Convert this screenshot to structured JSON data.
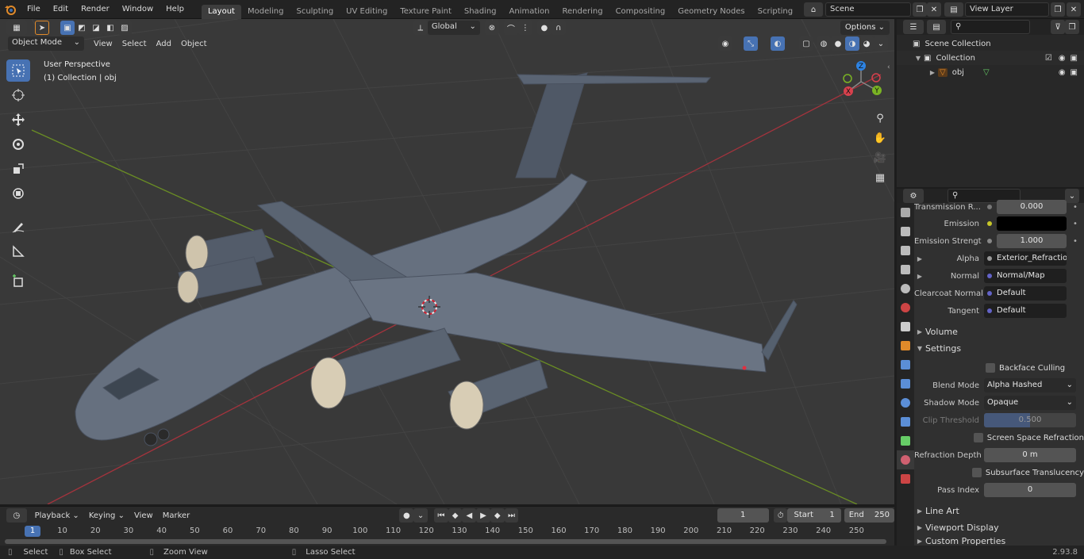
{
  "top_menu": {
    "file": "File",
    "edit": "Edit",
    "render": "Render",
    "window": "Window",
    "help": "Help"
  },
  "workspaces": [
    "Layout",
    "Modeling",
    "Sculpting",
    "UV Editing",
    "Texture Paint",
    "Shading",
    "Animation",
    "Rendering",
    "Compositing",
    "Geometry Nodes",
    "Scripting"
  ],
  "scene_field": "Scene",
  "view_layer_field": "View Layer",
  "viewport_header": {
    "mode": "Object Mode",
    "view": "View",
    "select": "Select",
    "add": "Add",
    "object": "Object",
    "transform_orientation": "Global",
    "options": "Options"
  },
  "viewport": {
    "perspective_label": "User Perspective",
    "collection_label": "(1) Collection | obj",
    "gizmo": {
      "x": "X",
      "y": "Y",
      "z": "Z"
    }
  },
  "timeline": {
    "playback": "Playback",
    "keying": "Keying",
    "view": "View",
    "marker": "Marker",
    "current_frame": "1",
    "start_label": "Start",
    "start_value": "1",
    "end_label": "End",
    "end_value": "250",
    "ticks": [
      "1",
      "10",
      "20",
      "30",
      "40",
      "50",
      "60",
      "70",
      "80",
      "90",
      "100",
      "110",
      "120",
      "130",
      "140",
      "150",
      "160",
      "170",
      "180",
      "190",
      "200",
      "210",
      "220",
      "230",
      "240",
      "250"
    ]
  },
  "statusbar": {
    "select": "Select",
    "box_select": "Box Select",
    "zoom_view": "Zoom View",
    "lasso_select": "Lasso Select",
    "version": "2.93.8"
  },
  "outliner": {
    "scene_collection": "Scene Collection",
    "collection": "Collection",
    "object": "obj"
  },
  "properties": {
    "transmission_label": "Transmission R...",
    "transmission_value": "0.000",
    "emission_label": "Emission",
    "emission_strength_label": "Emission Strengt",
    "emission_strength_value": "1.000",
    "alpha_label": "Alpha",
    "alpha_value": "Exterior_Refraction_...",
    "normal_label": "Normal",
    "normal_value": "Normal/Map",
    "clearcoat_normal_label": "Clearcoat Normal",
    "clearcoat_normal_value": "Default",
    "tangent_label": "Tangent",
    "tangent_value": "Default",
    "volume_section": "Volume",
    "settings_section": "Settings",
    "backface_culling": "Backface Culling",
    "blend_mode_label": "Blend Mode",
    "blend_mode_value": "Alpha Hashed",
    "shadow_mode_label": "Shadow Mode",
    "shadow_mode_value": "Opaque",
    "clip_threshold_label": "Clip Threshold",
    "clip_threshold_value": "0.500",
    "screen_space_refraction": "Screen Space Refraction",
    "refraction_depth_label": "Refraction Depth",
    "refraction_depth_value": "0 m",
    "subsurface_translucency": "Subsurface Translucency",
    "pass_index_label": "Pass Index",
    "pass_index_value": "0",
    "line_art_section": "Line Art",
    "viewport_display_section": "Viewport Display",
    "custom_properties_section": "Custom Properties"
  },
  "colors": {
    "accent": "#4772b3",
    "x_axis": "#d8414d",
    "y_axis": "#7ab324",
    "z_axis": "#2d83e3"
  }
}
